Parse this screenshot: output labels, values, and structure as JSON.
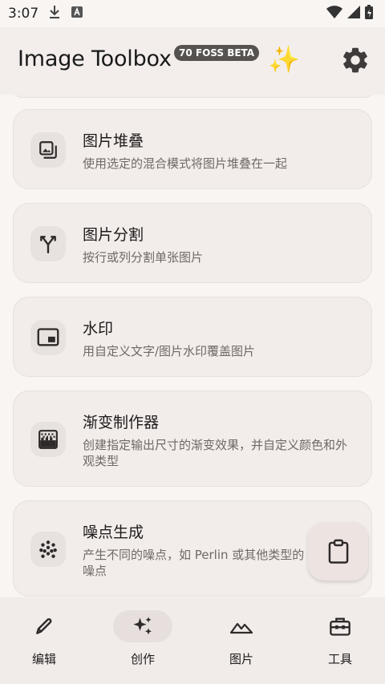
{
  "status_bar": {
    "time": "3:07"
  },
  "header": {
    "title": "Image Toolbox",
    "badge": "70 FOSS BETA"
  },
  "tools": [
    {
      "title": "图片堆叠",
      "subtitle": "使用选定的混合模式将图片堆叠在一起",
      "icon": "image-stack-icon"
    },
    {
      "title": "图片分割",
      "subtitle": "按行或列分割单张图片",
      "icon": "split-arrows-icon"
    },
    {
      "title": "水印",
      "subtitle": "用自定义文字/图片水印覆盖图片",
      "icon": "picture-in-picture-icon"
    },
    {
      "title": "渐变制作器",
      "subtitle": "创建指定输出尺寸的渐变效果，并自定义颜色和外观类型",
      "icon": "gradient-icon"
    },
    {
      "title": "噪点生成",
      "subtitle": "产生不同的噪点，如 Perlin 或其他类型的噪点",
      "icon": "noise-dots-icon"
    }
  ],
  "nav": [
    {
      "label": "编辑",
      "icon": "pencil-icon"
    },
    {
      "label": "创作",
      "icon": "sparkles-icon",
      "active": true
    },
    {
      "label": "图片",
      "icon": "mountains-icon"
    },
    {
      "label": "工具",
      "icon": "toolbox-icon"
    }
  ]
}
